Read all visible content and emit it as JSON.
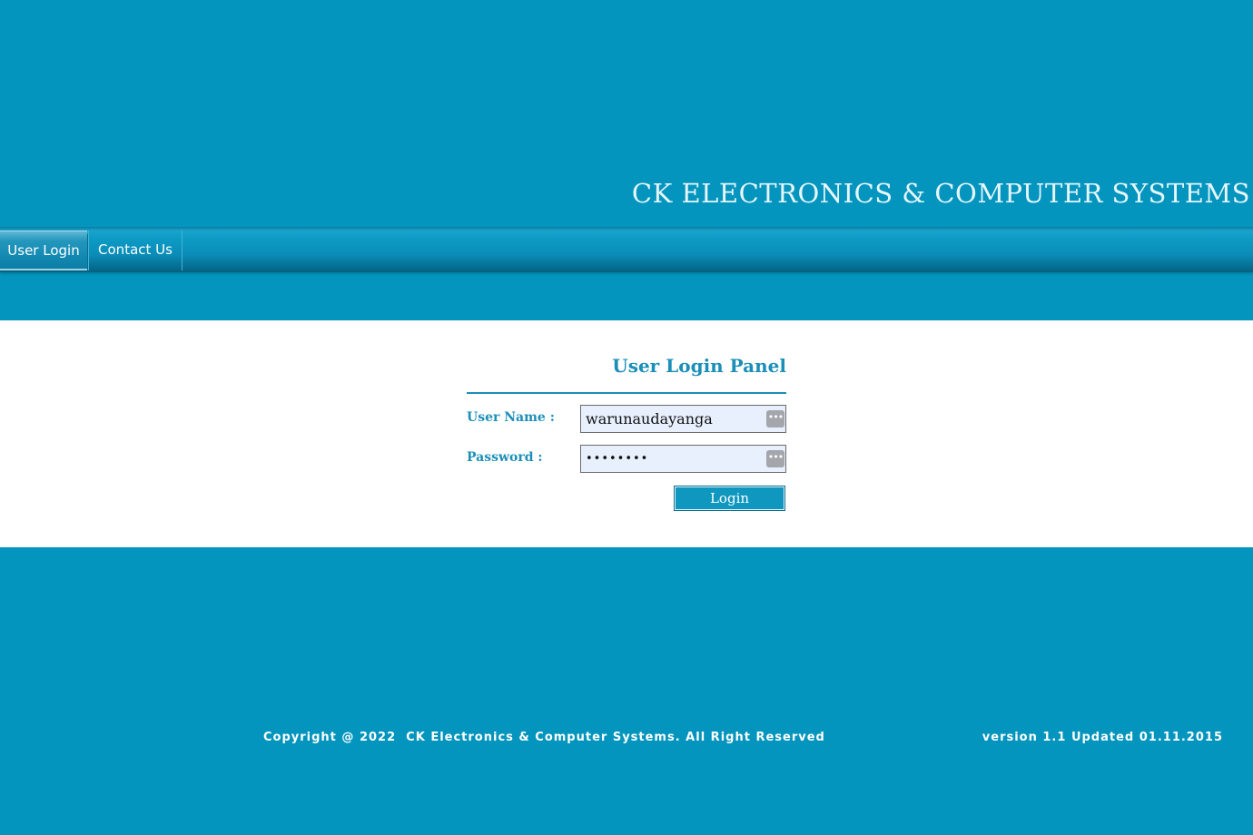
{
  "header": {
    "brand_title": "CK ELECTRONICS & COMPUTER SYSTEMS"
  },
  "nav": {
    "items": [
      {
        "label": "User Login",
        "active": true
      },
      {
        "label": "Contact Us",
        "active": false
      }
    ]
  },
  "login_panel": {
    "title": "User Login Panel",
    "username_label": "User Name :",
    "username_value": "warunaudayanga",
    "password_label": "Password :",
    "password_value": "••••••••",
    "login_button": "Login",
    "field_icon": "password-manager-icon"
  },
  "footer": {
    "copyright": "Copyright @ 2022  CK Electronics & Computer Systems. All Right Reserved",
    "version": "version 1.1 Updated 01.11.2015"
  },
  "colors": {
    "background": "#0395be",
    "accent": "#1a8fb8",
    "content_bg": "#ffffff",
    "field_bg": "#e8f0fe"
  }
}
